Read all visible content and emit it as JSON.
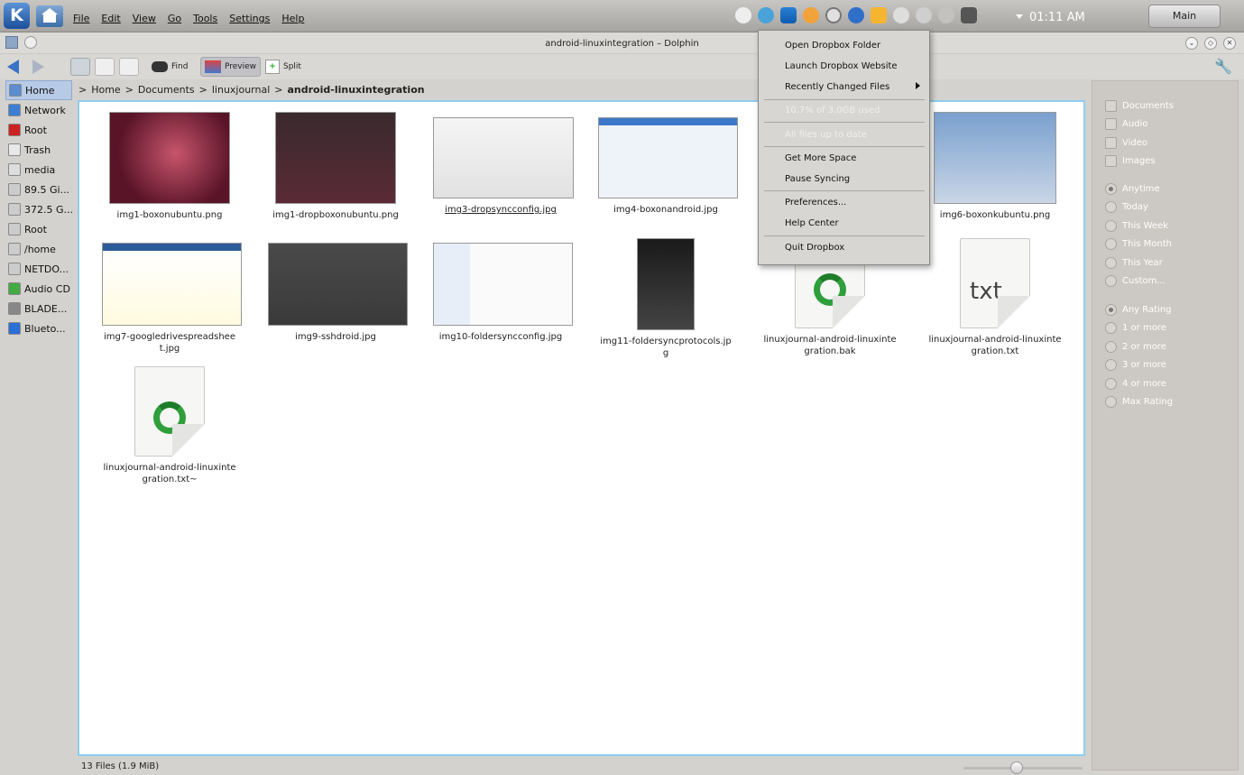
{
  "panel": {
    "menus": [
      "File",
      "Edit",
      "View",
      "Go",
      "Tools",
      "Settings",
      "Help"
    ],
    "clock": "01:11 AM",
    "desktop_label": "Main",
    "tray_icons": [
      "info-icon",
      "update-icon",
      "dropbox-icon",
      "moon-icon",
      "gear-icon",
      "network-icon",
      "clipboard-icon",
      "scissors-icon",
      "usb-icon",
      "volume-icon",
      "battery-icon"
    ]
  },
  "window": {
    "title": "android-linuxintegration – Dolphin"
  },
  "toolbar": {
    "find_label": "Find",
    "preview_label": "Preview",
    "split_label": "Split"
  },
  "places": [
    {
      "label": "Home",
      "icon": "home-folder-icon",
      "color": "#5b8ccf",
      "selected": true
    },
    {
      "label": "Network",
      "icon": "network-globe-icon",
      "color": "#3c7fd1"
    },
    {
      "label": "Root",
      "icon": "red-folder-icon",
      "color": "#cc2222"
    },
    {
      "label": "Trash",
      "icon": "trash-icon",
      "color": "#e8e8e8"
    },
    {
      "label": "media",
      "icon": "drive-icon",
      "color": "#dddddd"
    },
    {
      "label": "89.5 Gi...",
      "icon": "harddisk-icon",
      "color": "#cccccc"
    },
    {
      "label": "372.5 G...",
      "icon": "harddisk-icon",
      "color": "#cccccc"
    },
    {
      "label": "Root",
      "icon": "harddisk-icon",
      "color": "#cccccc"
    },
    {
      "label": "/home",
      "icon": "harddisk-icon",
      "color": "#cccccc"
    },
    {
      "label": "NETDO...",
      "icon": "harddisk-icon",
      "color": "#cccccc"
    },
    {
      "label": "Audio CD",
      "icon": "audio-cd-icon",
      "color": "#44aa44"
    },
    {
      "label": "BLADE...",
      "icon": "optical-drive-icon",
      "color": "#888888"
    },
    {
      "label": "Blueto...",
      "icon": "bluetooth-icon",
      "color": "#2a6fd6"
    }
  ],
  "breadcrumb": {
    "items": [
      "Home",
      "Documents",
      "linuxjournal"
    ],
    "current": "android-linuxintegration"
  },
  "files": [
    {
      "name": "img1-boxonubuntu.png",
      "thumb": "ubuntu-red"
    },
    {
      "name": "img1-dropboxonubuntu.png",
      "thumb": "ubuntu-dark"
    },
    {
      "name": "img3-dropsyncconfig.jpg",
      "thumb": "settings-light",
      "underline": true
    },
    {
      "name": "img4-boxonandroid.jpg",
      "thumb": "box"
    },
    {
      "name": "img6-boxonkubuntu.png",
      "thumb": "kde"
    },
    {
      "name": "img7-googledrivespreadsheet.jpg",
      "thumb": "spreadsheet"
    },
    {
      "name": "img9-sshdroid.jpg",
      "thumb": "dark"
    },
    {
      "name": "img10-foldersyncconfig.jpg",
      "thumb": "foldersync"
    },
    {
      "name": "img11-foldersyncprotocols.jpg",
      "thumb": "phone"
    },
    {
      "name": "linuxjournal-android-linuxintegration.bak",
      "thumb": "recycle"
    },
    {
      "name": "linuxjournal-android-linuxintegration.txt",
      "thumb": "txt"
    },
    {
      "name": "linuxjournal-android-linuxintegration.txt~",
      "thumb": "recycle"
    }
  ],
  "status": {
    "summary": "13 Files (1.9 MiB)"
  },
  "filters": {
    "types": [
      "Documents",
      "Audio",
      "Video",
      "Images"
    ],
    "dates": [
      "Anytime",
      "Today",
      "This Week",
      "This Month",
      "This Year",
      "Custom..."
    ],
    "ratings": [
      "Any Rating",
      "1 or more",
      "2 or more",
      "3 or more",
      "4 or more",
      "Max Rating"
    ]
  },
  "dropbox_menu": {
    "open_folder": "Open Dropbox Folder",
    "launch_website": "Launch Dropbox Website",
    "recent_files": "Recently Changed Files",
    "usage": "10.7% of 3.0GB used",
    "sync_status": "All files up to date",
    "get_space": "Get More Space",
    "pause": "Pause Syncing",
    "preferences": "Preferences...",
    "help": "Help Center",
    "quit": "Quit Dropbox"
  }
}
